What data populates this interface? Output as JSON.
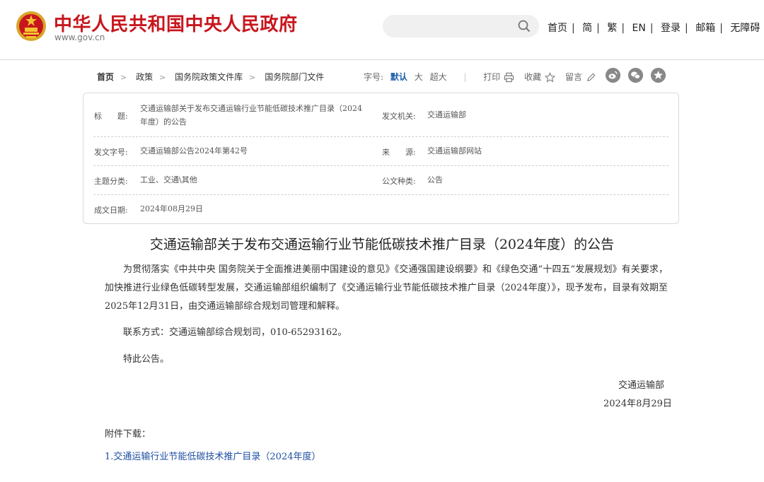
{
  "header": {
    "site_title": "中华人民共和国中央人民政府",
    "site_url": "www.gov.cn",
    "nav": [
      "首页",
      "简",
      "繁",
      "EN",
      "登录",
      "邮箱",
      "无障碍"
    ]
  },
  "breadcrumb": [
    "首页",
    "政策",
    "国务院政策文件库",
    "国务院部门文件"
  ],
  "toolbar": {
    "font_label": "字号:",
    "font_sizes": [
      "默认",
      "大",
      "超大"
    ],
    "print": "打印",
    "favorite": "收藏",
    "comment": "留言"
  },
  "meta": {
    "title_label": "标　　题:",
    "title_line1": "交通运输部关于发布交通运输行业节能低碳技术推广目录（2024",
    "title_line2": "年度）的公告",
    "issuer_label": "发文机关:",
    "issuer": "交通运输部",
    "doc_no_label": "发文字号:",
    "doc_no": "交通运输部公告2024年第42号",
    "source_label": "来　　源:",
    "source": "交通运输部网站",
    "topic_label": "主题分类:",
    "topic": "工业、交通\\其他",
    "type_label": "公文种类:",
    "type": "公告",
    "date_label": "成文日期:",
    "date": "2024年08月29日"
  },
  "article": {
    "title": "交通运输部关于发布交通运输行业节能低碳技术推广目录（2024年度）的公告",
    "para1": "为贯彻落实《中共中央 国务院关于全面推进美丽中国建设的意见》《交通强国建设纲要》和《绿色交通“十四五”发展规划》有关要求，加快推进行业绿色低碳转型发展，交通运输部组织编制了《交通运输行业节能低碳技术推广目录（2024年度）》，现予发布，目录有效期至2025年12月31日，由交通运输部综合规划司管理和解释。",
    "para2": "联系方式：交通运输部综合规划司，010-65293162。",
    "para3": "特此公告。",
    "sign_org": "交通运输部",
    "sign_date": "2024年8月29日",
    "attach_label": "附件下载：",
    "attach_link": "1.交通运输行业节能低碳技术推广目录（2024年度）"
  },
  "colors": {
    "brand_red": "#c8161e",
    "link_blue": "#1d4ea2",
    "accent_blue": "#1a5fa8"
  }
}
